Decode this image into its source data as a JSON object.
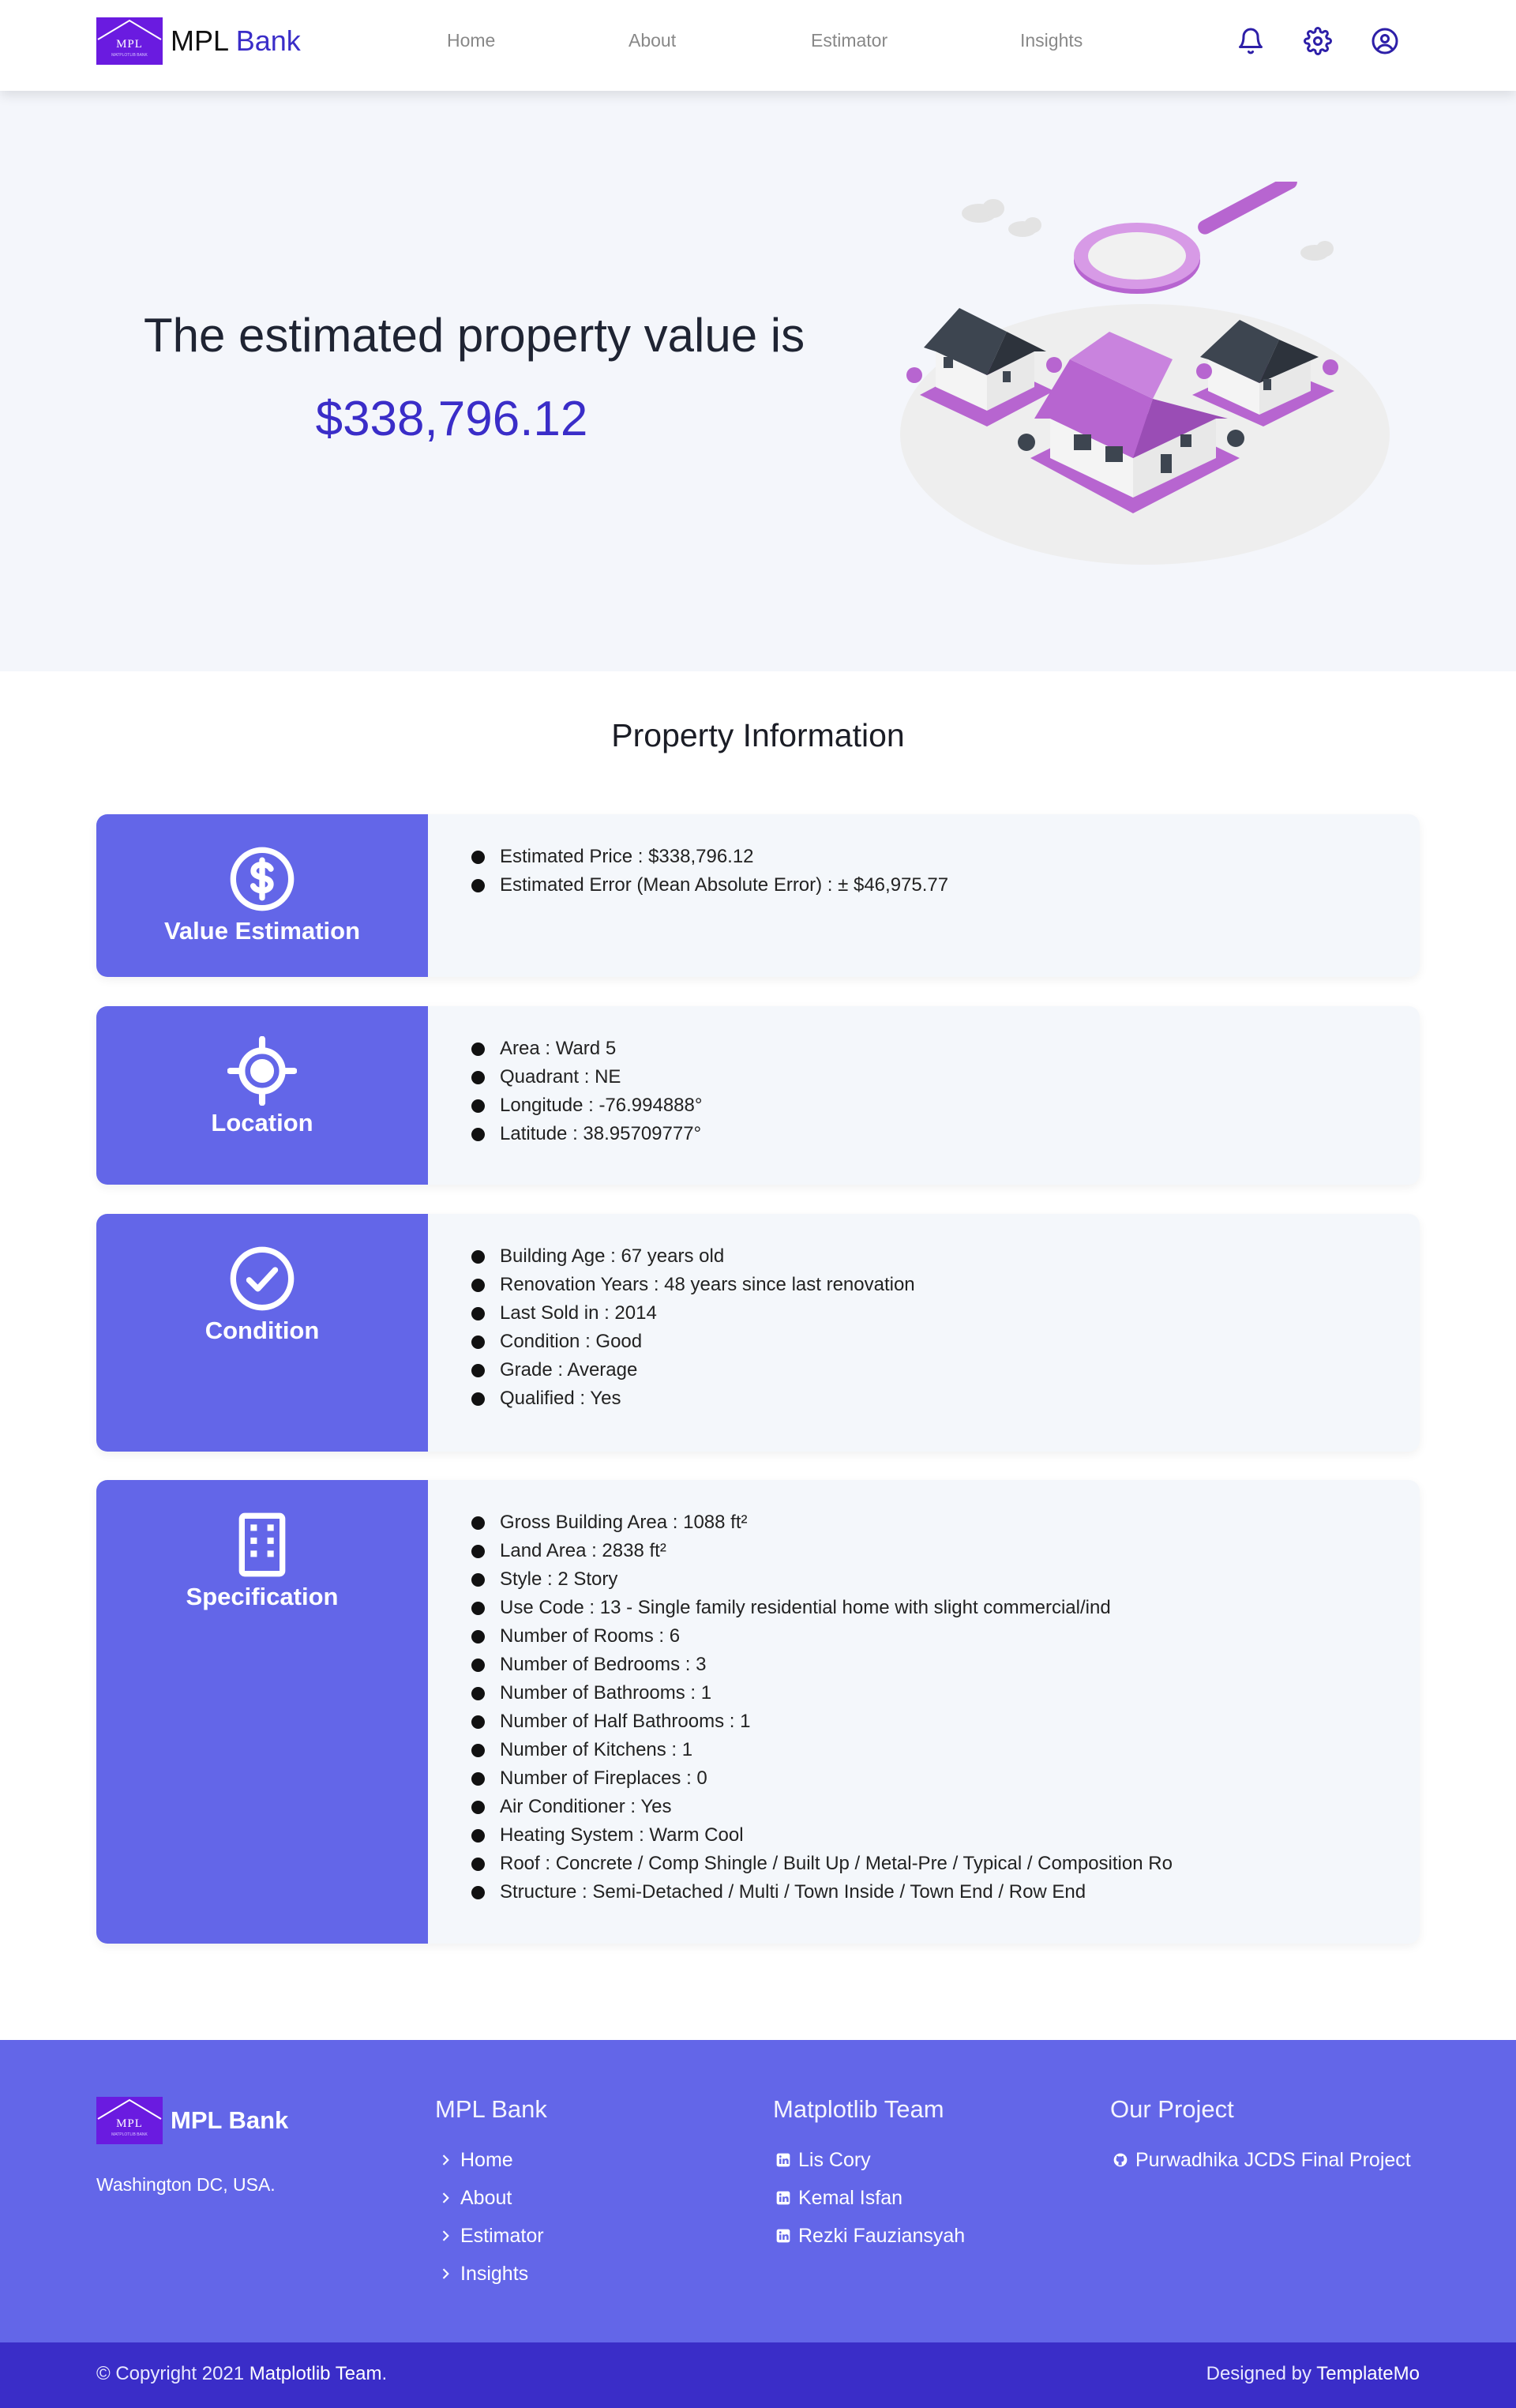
{
  "brand": {
    "logo_text": "MPL",
    "logo_subtext": "MATPLOTLIB BANK",
    "name_part1": "MPL",
    "name_part2": "Bank"
  },
  "nav": {
    "items": [
      "Home",
      "About",
      "Estimator",
      "Insights"
    ]
  },
  "header_icons": [
    "bell-icon",
    "gear-icon",
    "user-circle-icon"
  ],
  "hero": {
    "title": "The estimated property value is",
    "value": "$338,796.12"
  },
  "section": {
    "title": "Property Information"
  },
  "cards": [
    {
      "label": "Value Estimation",
      "icon": "dollar-circle-icon",
      "items": [
        "Estimated Price : $338,796.12",
        "Estimated Error (Mean Absolute Error) : ± $46,975.77"
      ]
    },
    {
      "label": "Location",
      "icon": "crosshair-icon",
      "items": [
        "Area : Ward 5",
        "Quadrant : NE",
        "Longitude : -76.994888°",
        "Latitude : 38.95709777°"
      ]
    },
    {
      "label": "Condition",
      "icon": "check-circle-icon",
      "items": [
        "Building Age : 67 years old",
        "Renovation Years : 48 years since last renovation",
        "Last Sold in : 2014",
        "Condition : Good",
        "Grade : Average",
        "Qualified : Yes"
      ]
    },
    {
      "label": "Specification",
      "icon": "building-icon",
      "items": [
        "Gross Building Area : 1088 ft²",
        "Land Area : 2838 ft²",
        "Style : 2 Story",
        "Use Code : 13 - Single family residential home with slight commercial/ind",
        "Number of Rooms : 6",
        "Number of Bedrooms : 3",
        "Number of Bathrooms : 1",
        "Number of Half Bathrooms : 1",
        "Number of Kitchens : 1",
        "Number of Fireplaces : 0",
        "Air Conditioner : Yes",
        "Heating System : Warm Cool",
        "Roof : Concrete / Comp Shingle / Built Up / Metal-Pre / Typical / Composition Ro",
        "Structure : Semi-Detached / Multi / Town Inside / Town End / Row End"
      ]
    }
  ],
  "footer": {
    "brand_name": "MPL Bank",
    "address": "Washington DC, USA.",
    "col1": {
      "title": "MPL Bank",
      "links": [
        "Home",
        "About",
        "Estimator",
        "Insights"
      ]
    },
    "col2": {
      "title": "Matplotlib Team",
      "links": [
        "Lis Cory",
        "Kemal Isfan",
        "Rezki Fauziansyah"
      ]
    },
    "col3": {
      "title": "Our Project",
      "links": [
        "Purwadhika JCDS Final Project"
      ]
    },
    "copyright_prefix": "© Copyright 2021 ",
    "copyright_team": "Matplotlib Team",
    "copyright_suffix": ".",
    "designed_prefix": "Designed by ",
    "designed_by": "TemplateMo"
  },
  "colors": {
    "primary": "#6366e8",
    "accent": "#3a2dc8",
    "logo_bg": "#6a1be0",
    "hero_bg": "#f4f6fb",
    "card_bg": "#f4f7fb",
    "illustration_purple": "#b765d0"
  }
}
